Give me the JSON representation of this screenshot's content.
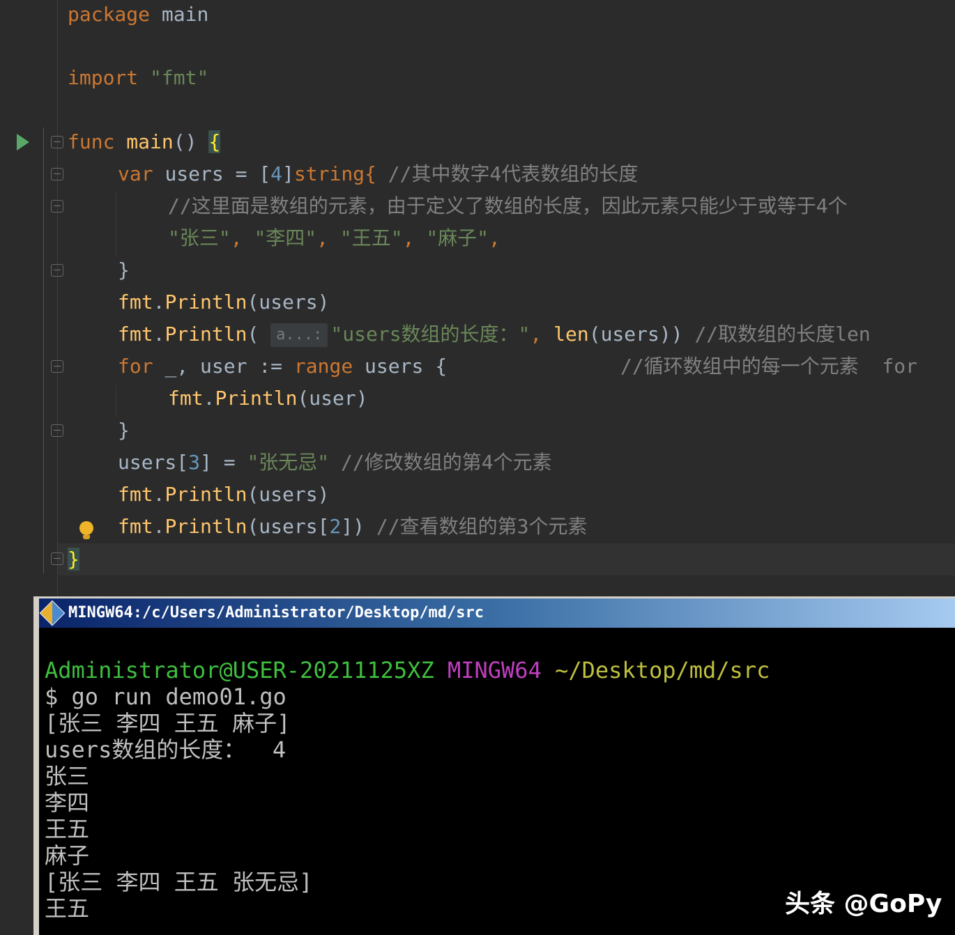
{
  "editor": {
    "lines": {
      "l1": {
        "kw": "package",
        "name": "main"
      },
      "l2": {
        "kw": "import",
        "str": "\"fmt\""
      },
      "l3": {
        "kw": "func",
        "name": "main",
        "parens": "()",
        "brace": "{"
      },
      "l4": {
        "kw": "var",
        "ident": "users",
        "op": "=",
        "bopen": "[",
        "num": "4",
        "bclose": "]",
        "type": "string{",
        "comment": "//其中数字4代表数组的长度"
      },
      "l5": {
        "comment": "//这里面是数组的元素，由于定义了数组的长度，因此元素只能少于或等于4个"
      },
      "l6": {
        "s1": "\"张三\"",
        "s2": "\"李四\"",
        "s3": "\"王五\"",
        "s4": "\"麻子\"",
        "comma": ","
      },
      "l7": {
        "brace": "}"
      },
      "l8": {
        "pkg": "fmt",
        "fn": "Println",
        "arg": "(users)"
      },
      "l9": {
        "pkg": "fmt",
        "fn": "Println",
        "open": "(",
        "hint": "a...:",
        "str": "\"users数组的长度：\"",
        "comma": ",",
        "len": "len",
        "arg": "(users))",
        "comment": "//取数组的长度len"
      },
      "l10": {
        "kw": "for",
        "blank": "_,",
        "ident": "user",
        "op": ":=",
        "range": "range",
        "tail": "users {",
        "comment": "//循环数组中的每一个元素  for"
      },
      "l11": {
        "pkg": "fmt",
        "fn": "Println",
        "arg": "(user)"
      },
      "l12": {
        "brace": "}"
      },
      "l13": {
        "ident": "users",
        "bopen": "[",
        "num": "3",
        "bclose": "]",
        "op": "=",
        "str": "\"张无忌\"",
        "comment": "//修改数组的第4个元素"
      },
      "l14": {
        "pkg": "fmt",
        "fn": "Println",
        "arg": "(users)"
      },
      "l15": {
        "pkg": "fmt",
        "fn": "Println",
        "open": "(users[",
        "num": "2",
        "close": "])",
        "comment": "//查看数组的第3个元素"
      },
      "l16": {
        "brace": "}"
      }
    }
  },
  "terminal": {
    "title": "MINGW64:/c/Users/Administrator/Desktop/md/src",
    "prompt_user": "Administrator@USER-20211125XZ",
    "prompt_env": "MINGW64",
    "prompt_path": "~/Desktop/md/src",
    "command": "$ go run demo01.go",
    "output": [
      "[张三 李四 王五 麻子]",
      "users数组的长度：  4",
      "张三",
      "李四",
      "王五",
      "麻子",
      "[张三 李四 王五 张无忌]",
      "王五"
    ]
  },
  "watermark": "头条 @GoPy",
  "colors": {
    "keyword": "#cc7832",
    "function": "#ffc66d",
    "string": "#6a8759",
    "number": "#6897bb",
    "comment": "#808080",
    "identifier": "#a9b7c6",
    "run_icon": "#59a869",
    "terminal_green": "#3fbf3f",
    "terminal_magenta": "#bf3fbf",
    "terminal_yellow": "#bfbf3f"
  }
}
